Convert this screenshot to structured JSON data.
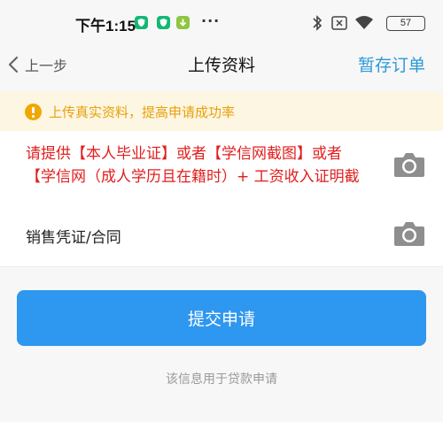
{
  "status_bar": {
    "time": "下午1:15",
    "dots": "···",
    "battery": "57"
  },
  "nav": {
    "back_label": "上一步",
    "title": "上传资料",
    "action_label": "暂存订单"
  },
  "notice": {
    "text": "上传真实资料，提高申请成功率"
  },
  "upload_items": [
    {
      "line1": "请提供【本人毕业证】或者【学信网截图】或者",
      "line2": "【学信网（成人学历且在籍时）+ 工资收入证明截"
    },
    {
      "label": "销售凭证/合同"
    }
  ],
  "submit_label": "提交申请",
  "footnote": "该信息用于贷款申请",
  "colors": {
    "accent": "#2e97f0",
    "nav_action": "#2a9ad8",
    "warning_text": "#e8a10a",
    "required_text": "#e21e1e"
  },
  "icons": [
    "back-chevron-icon",
    "warning-icon",
    "camera-icon",
    "bluetooth-icon",
    "wifi-icon",
    "battery-icon"
  ]
}
